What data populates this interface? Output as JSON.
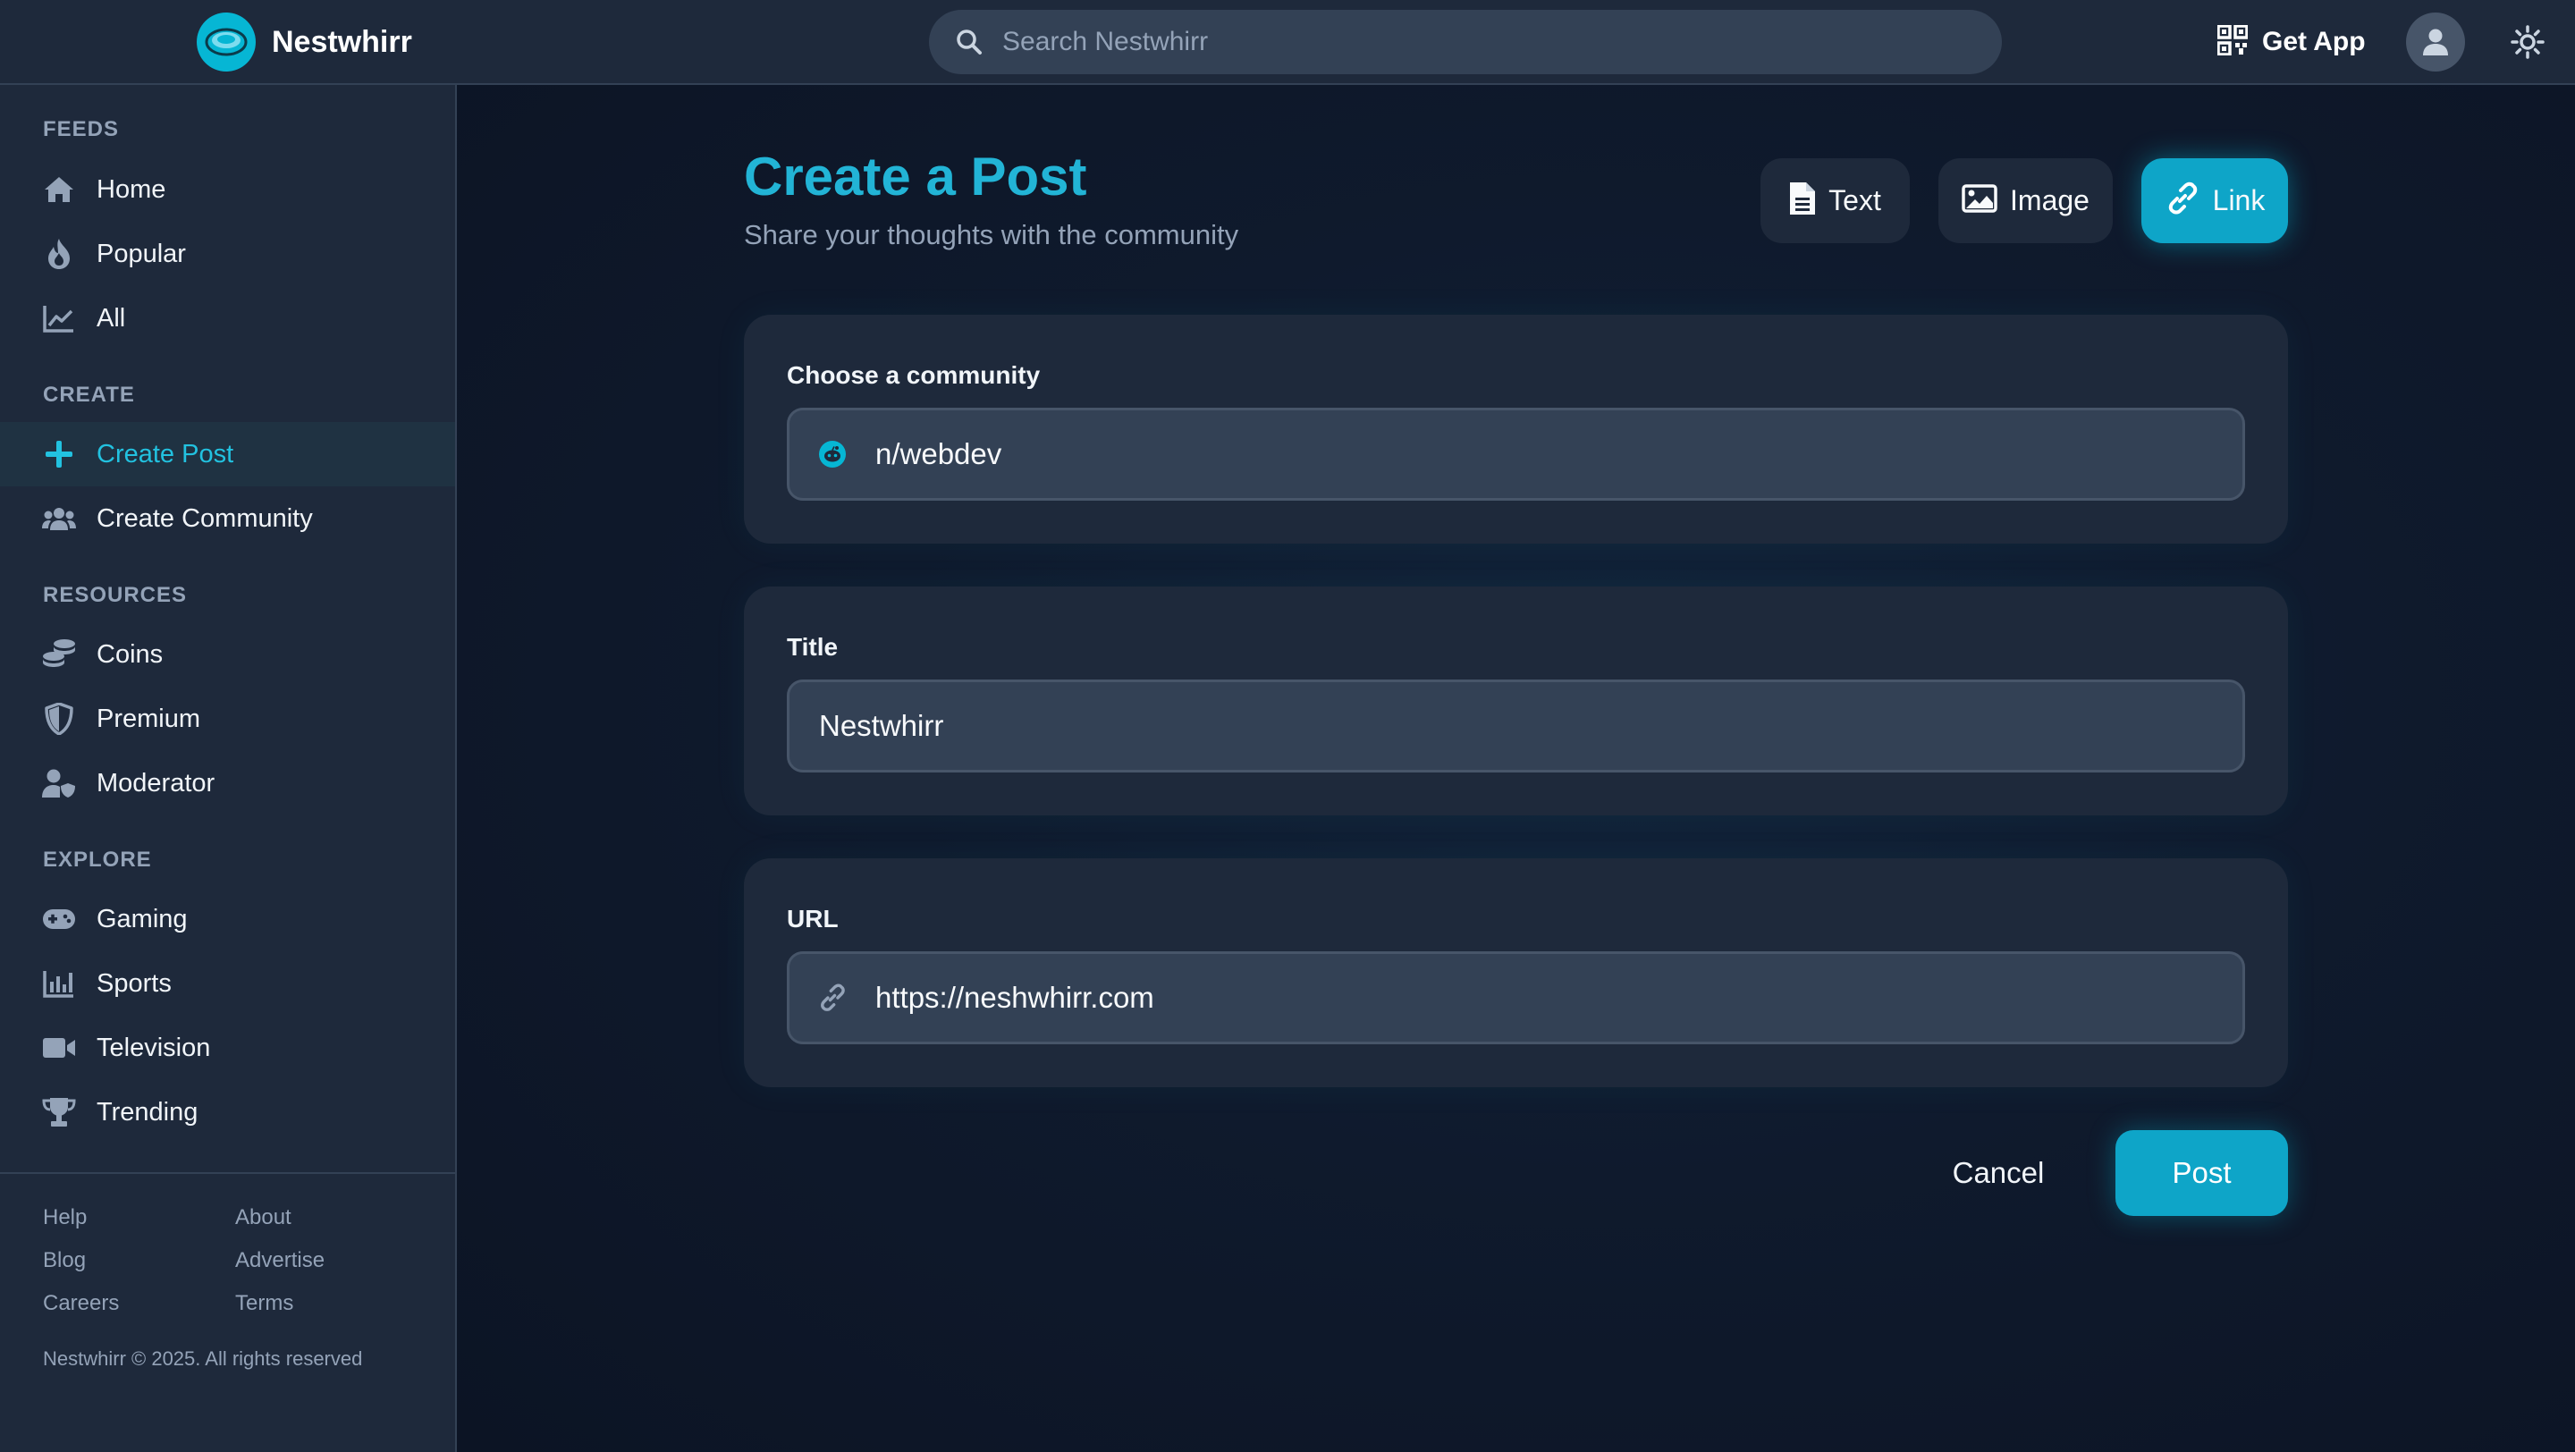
{
  "header": {
    "brand_name": "Nestwhirr",
    "search_placeholder": "Search Nestwhirr",
    "get_app_label": "Get App"
  },
  "sidebar": {
    "sections": {
      "feeds": "FEEDS",
      "create": "CREATE",
      "resources": "RESOURCES",
      "explore": "EXPLORE"
    },
    "feeds": [
      {
        "label": "Home",
        "icon": "home-icon"
      },
      {
        "label": "Popular",
        "icon": "flame-icon"
      },
      {
        "label": "All",
        "icon": "chart-line-icon"
      }
    ],
    "create": [
      {
        "label": "Create Post",
        "icon": "plus-icon",
        "active": true
      },
      {
        "label": "Create Community",
        "icon": "users-icon"
      }
    ],
    "resources": [
      {
        "label": "Coins",
        "icon": "coins-icon"
      },
      {
        "label": "Premium",
        "icon": "shield-icon"
      },
      {
        "label": "Moderator",
        "icon": "user-shield-icon"
      }
    ],
    "explore": [
      {
        "label": "Gaming",
        "icon": "gamepad-icon"
      },
      {
        "label": "Sports",
        "icon": "bar-chart-icon"
      },
      {
        "label": "Television",
        "icon": "video-icon"
      },
      {
        "label": "Trending",
        "icon": "trophy-icon"
      }
    ],
    "footer_links": [
      "Help",
      "About",
      "Blog",
      "Advertise",
      "Careers",
      "Terms"
    ],
    "copyright": "Nestwhirr © 2025. All rights reserved"
  },
  "main": {
    "title": "Create a Post",
    "subtitle": "Share your thoughts with the community",
    "post_types": [
      {
        "label": "Text",
        "icon": "file-text-icon"
      },
      {
        "label": "Image",
        "icon": "image-icon"
      },
      {
        "label": "Link",
        "icon": "link-icon",
        "active": true
      }
    ],
    "community": {
      "label": "Choose a community",
      "value": "n/webdev"
    },
    "title_field": {
      "label": "Title",
      "value": "Nestwhirr"
    },
    "url_field": {
      "label": "URL",
      "value": "https://neshwhirr.com"
    },
    "cancel_label": "Cancel",
    "post_label": "Post"
  },
  "colors": {
    "accent": "#06b6d4",
    "background": "#0f172a",
    "panel": "#1e293b",
    "input": "#334155"
  }
}
